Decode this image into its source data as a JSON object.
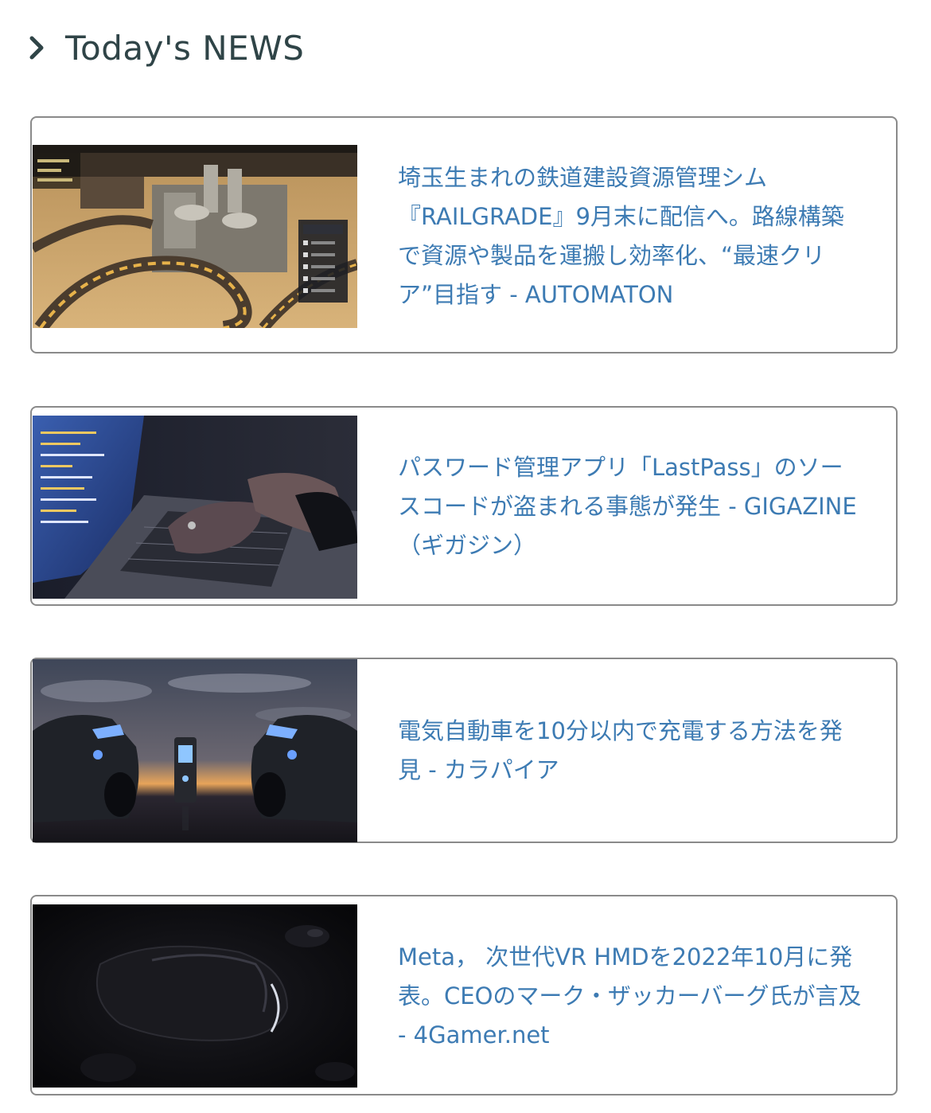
{
  "section": {
    "title": "Today's NEWS",
    "icon": "chevron-right-icon"
  },
  "colors": {
    "headline": "#3d7bb3",
    "title": "#2f4447",
    "card_border": "#8a8a8a"
  },
  "news": [
    {
      "headline": "埼玉生まれの鉄道建設資源管理シム『RAILGRADE』9月末に配信へ。路線構築で資源や製品を運搬し効率化、“最速クリア”目指す - AUTOMATON",
      "thumbnail": "railway-game-screenshot"
    },
    {
      "headline": "パスワード管理アプリ「LastPass」のソースコードが盗まれる事態が発生 - GIGAZINE（ギガジン）",
      "thumbnail": "laptop-typing-photo"
    },
    {
      "headline": "電気自動車を10分以内で充電する方法を発見 - カラパイア",
      "thumbnail": "electric-cars-charging-photo"
    },
    {
      "headline": "Meta， 次世代VR HMDを2022年10月に発表。CEOのマーク・ザッカーバーグ氏が言及 - 4Gamer.net",
      "thumbnail": "vr-headset-render"
    }
  ]
}
